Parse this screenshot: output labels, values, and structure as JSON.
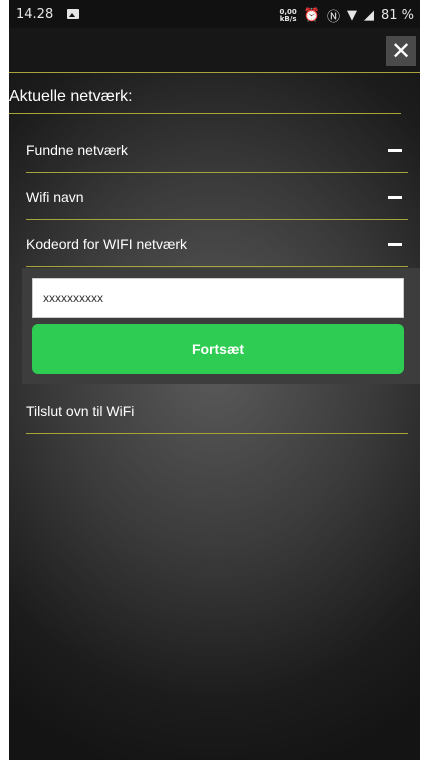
{
  "status_bar": {
    "time": "14.28",
    "speed_value": "0,00",
    "speed_unit": "kB/s",
    "battery": "81 %"
  },
  "header": {
    "close_glyph": "✕"
  },
  "section_title": "Aktuelle netværk:",
  "rows": [
    {
      "label": "Fundne netværk",
      "icon": "minus-icon"
    },
    {
      "label": "Wifi navn",
      "icon": "minus-icon"
    },
    {
      "label": "Kodeord for WIFI netværk",
      "icon": "minus-icon"
    }
  ],
  "password_form": {
    "value": "xxxxxxxxxx",
    "button_label": "Fortsæt"
  },
  "connect_row": {
    "label": "Tilslut ovn til WiFi"
  },
  "colors": {
    "accent_line": "#a9a43a",
    "button_green": "#2ecc52"
  }
}
